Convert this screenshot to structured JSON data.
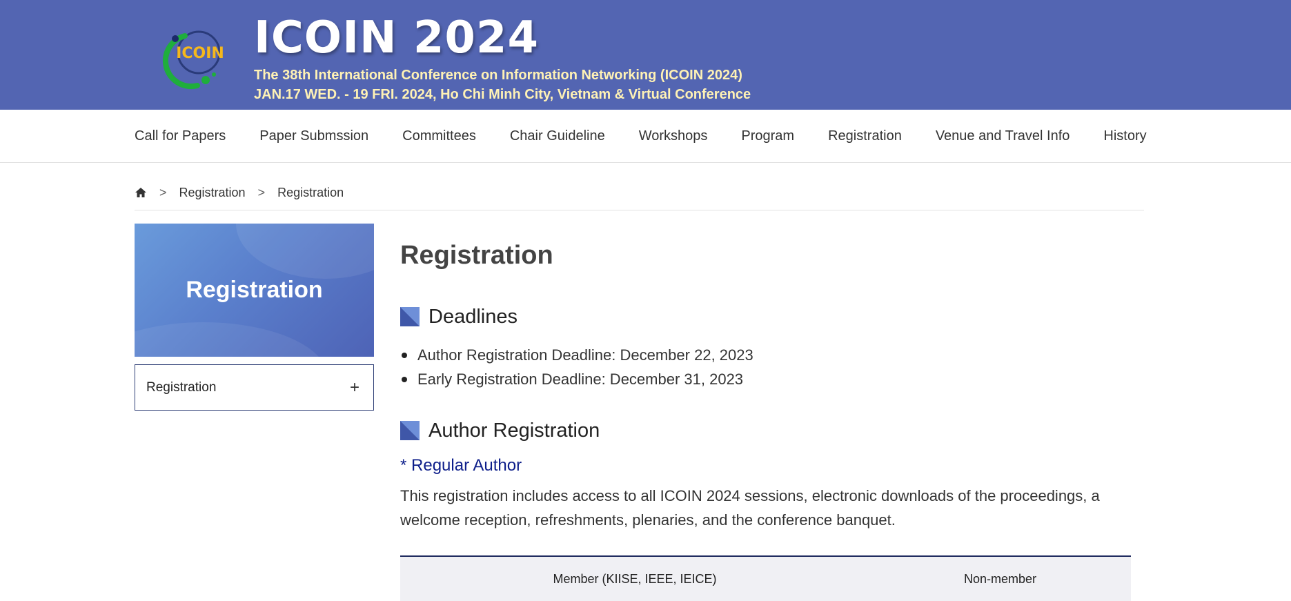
{
  "header": {
    "logo_text": "ICOIN",
    "title": "ICOIN 2024",
    "subtitle": "The 38th International Conference on Information Networking (ICOIN 2024)",
    "dates": "JAN.17 WED. - 19 FRI. 2024, Ho Chi Minh City, Vietnam & Virtual Conference",
    "bg_color": "#5365b2"
  },
  "nav": {
    "items": [
      "Call for Papers",
      "Paper Submssion",
      "Committees",
      "Chair Guideline",
      "Workshops",
      "Program",
      "Registration",
      "Venue and Travel Info",
      "History"
    ]
  },
  "breadcrumb": {
    "home_icon": "home-icon",
    "sep": ">",
    "items": [
      "Registration",
      "Registration"
    ]
  },
  "sidebar": {
    "banner_title": "Registration",
    "menu": [
      {
        "label": "Registration",
        "icon": "+"
      }
    ]
  },
  "content": {
    "title": "Registration",
    "deadlines": {
      "heading": "Deadlines",
      "items": [
        "Author Registration Deadline: December 22, 2023",
        "Early Registration Deadline: December 31, 2023"
      ]
    },
    "author_registration": {
      "heading": "Author Registration",
      "subheading": "* Regular Author",
      "description": "This registration includes access to all ICOIN 2024 sessions, electronic downloads of the proceedings, a welcome reception, refreshments, plenaries, and the conference banquet."
    },
    "table": {
      "headers": [
        "Member (KIISE, IEEE, IEICE)",
        "Non-member"
      ]
    }
  }
}
